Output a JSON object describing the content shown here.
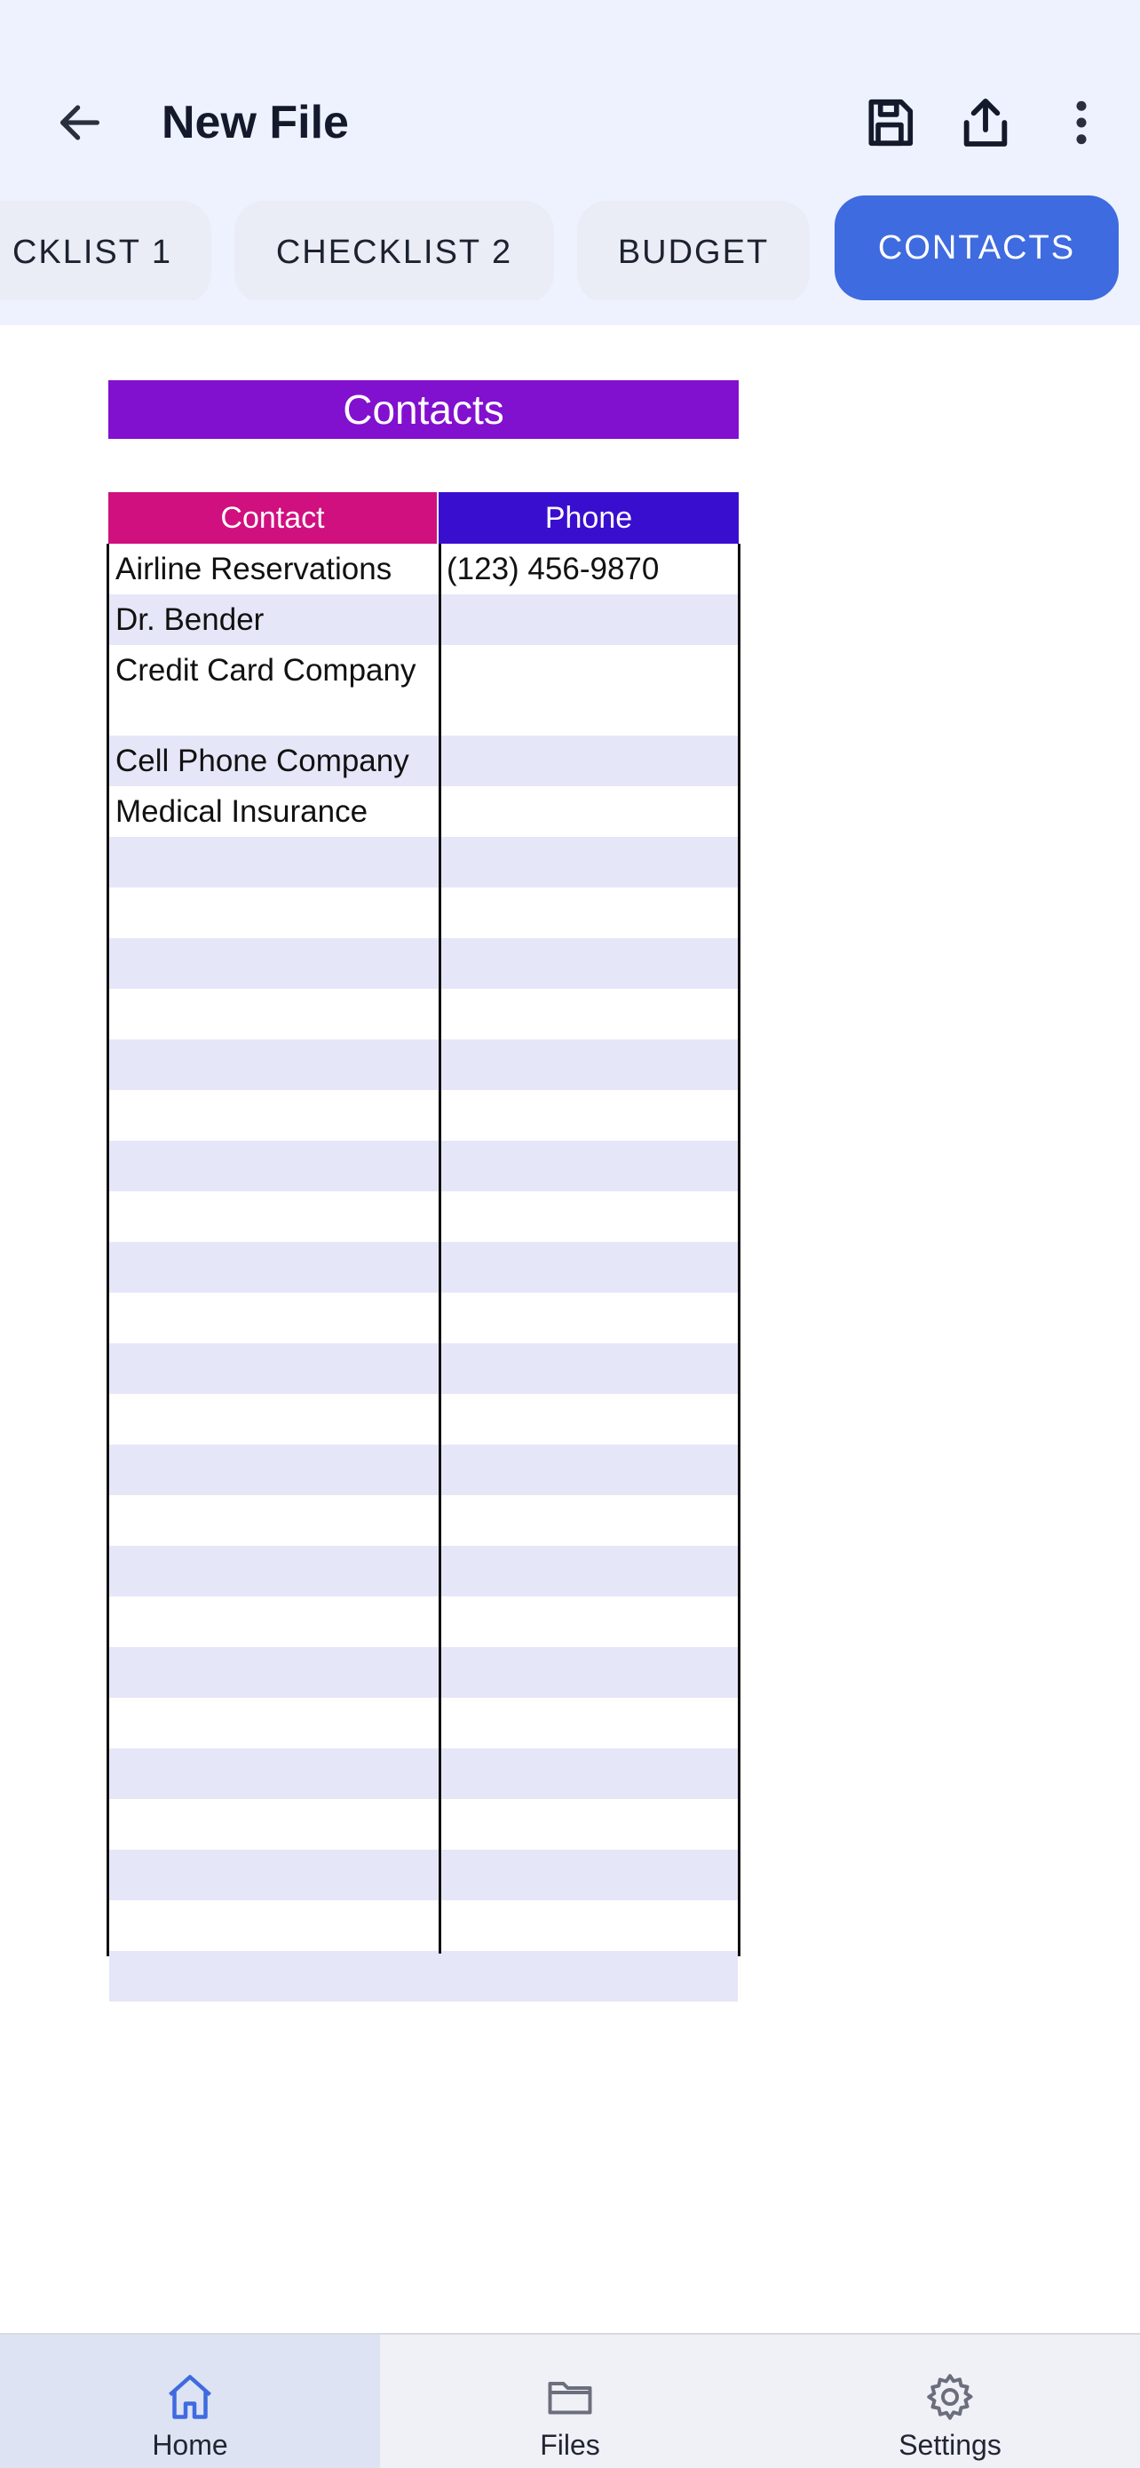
{
  "header": {
    "title": "New File",
    "icons": {
      "back": "arrow-left-icon",
      "save": "floppy-disk-icon",
      "share": "share-upload-icon",
      "more": "more-vertical-icon"
    }
  },
  "tabs": [
    {
      "label": "CKLIST 1",
      "active": false
    },
    {
      "label": "CHECKLIST 2",
      "active": false
    },
    {
      "label": "BUDGET",
      "active": false
    },
    {
      "label": "CONTACTS",
      "active": true
    }
  ],
  "sheet": {
    "title": "Contacts",
    "columns": [
      "Contact",
      "Phone"
    ],
    "rows": [
      [
        "Airline Reservations",
        "(123) 456-9870"
      ],
      [
        "Dr. Bender",
        ""
      ],
      [
        "Credit Card Company",
        ""
      ],
      [
        "Cell Phone Company",
        ""
      ],
      [
        "Medical Insurance",
        ""
      ],
      [
        "",
        ""
      ],
      [
        "",
        ""
      ],
      [
        "",
        ""
      ],
      [
        "",
        ""
      ],
      [
        "",
        ""
      ],
      [
        "",
        ""
      ],
      [
        "",
        ""
      ],
      [
        "",
        ""
      ],
      [
        "",
        ""
      ],
      [
        "",
        ""
      ],
      [
        "",
        ""
      ],
      [
        "",
        ""
      ],
      [
        "",
        ""
      ],
      [
        "",
        ""
      ],
      [
        "",
        ""
      ],
      [
        "",
        ""
      ],
      [
        "",
        ""
      ],
      [
        "",
        ""
      ],
      [
        "",
        ""
      ],
      [
        "",
        ""
      ],
      [
        "",
        ""
      ],
      [
        "",
        ""
      ],
      [
        "",
        ""
      ]
    ]
  },
  "colors": {
    "title_bg": "#8210cf",
    "contact_header_bg": "#d0107f",
    "phone_header_bg": "#3a0ecf",
    "row_stripe": "#e5e7f8",
    "active_tab": "#3f6be0",
    "accent": "#3f6be0"
  },
  "bottom_nav": [
    {
      "label": "Home",
      "icon": "home-icon",
      "active": true
    },
    {
      "label": "Files",
      "icon": "folder-icon",
      "active": false
    },
    {
      "label": "Settings",
      "icon": "gear-icon",
      "active": false
    }
  ]
}
